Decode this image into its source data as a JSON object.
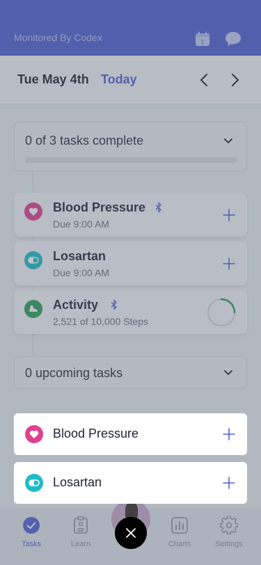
{
  "header": {
    "brand": "Monitored By Codex",
    "calendar_day": "1"
  },
  "datebar": {
    "date": "Tue May 4th",
    "today_label": "Today"
  },
  "progress": {
    "label": "0 of 3 tasks complete",
    "completed": 0,
    "total": 3
  },
  "tasks": [
    {
      "name": "Blood Pressure",
      "subtitle": "Due 9:00 AM",
      "icon": "heart-icon",
      "color": "#e0408e",
      "bluetooth": true
    },
    {
      "name": "Losartan",
      "subtitle": "Due 9:00 AM",
      "icon": "pill-icon",
      "color": "#1fbcc5",
      "bluetooth": false
    },
    {
      "name": "Activity",
      "subtitle": "2,521 of 10,000 Steps",
      "icon": "shoe-icon",
      "color": "#2e9e5a",
      "bluetooth": true,
      "steps": 2521,
      "goal": 10000
    }
  ],
  "upcoming": {
    "label": "0 upcoming tasks"
  },
  "popup": [
    {
      "name": "Blood Pressure",
      "icon": "heart-icon",
      "color": "#e0408e"
    },
    {
      "name": "Losartan",
      "icon": "pill-icon",
      "color": "#1fbcc5"
    }
  ],
  "tabs": [
    {
      "label": "Tasks",
      "icon": "check-circle-icon",
      "active": true
    },
    {
      "label": "Learn",
      "icon": "clipboard-icon",
      "active": false
    },
    {
      "label": "Charts",
      "icon": "bar-chart-icon",
      "active": false
    },
    {
      "label": "Settings",
      "icon": "gear-icon",
      "active": false
    }
  ],
  "colors": {
    "accent": "#5362d4",
    "header": "#4e5ed2"
  }
}
